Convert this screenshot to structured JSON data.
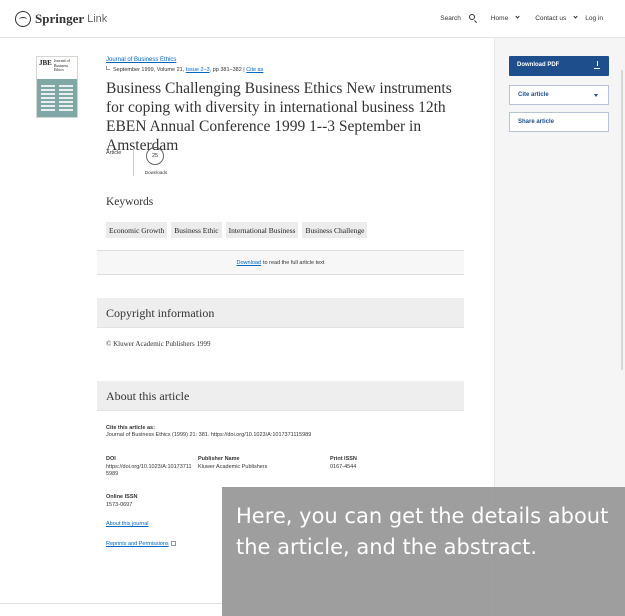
{
  "header": {
    "logo_brand": "Springer",
    "logo_product": "Link",
    "nav": {
      "search": "Search",
      "home": "Home",
      "contact": "Contact us",
      "login": "Log in"
    }
  },
  "cover": {
    "badge": "JBE",
    "title": "Journal of Business Ethics"
  },
  "article": {
    "journal": "Journal of Business Ethics",
    "date_volume": "September 1999, Volume 21,",
    "issue_link": "Issue 2–3",
    "pages": ", pp 381–382 |",
    "cite_link": "Cite as",
    "title": "Business Challenging Business Ethics New instruments for coping with diversity in international business 12th EBEN Annual Conference 1999 1--3 September in Amsterdam",
    "type": "Article",
    "downloads_count": "25",
    "downloads_label": "Downloads"
  },
  "keywords": {
    "heading": "Keywords",
    "items": [
      "Economic Growth",
      "Business Ethic",
      "International Business",
      "Business Challenge"
    ]
  },
  "download_box": {
    "link": "Download",
    "text": "to read the full article text"
  },
  "copyright": {
    "heading": "Copyright information",
    "text": "© Kluwer Academic Publishers 1999"
  },
  "about": {
    "heading": "About this article",
    "cite_label": "Cite this article as:",
    "cite_text": "Journal of Business Ethics (1999) 21: 381. https://doi.org/10.1023/A:1017371115989",
    "doi_label": "DOI",
    "doi_value_1": "https://doi.org/10.1023/A:10173711",
    "doi_value_2": "5989",
    "publisher_label": "Publisher Name",
    "publisher_value": "Kluwer Academic Publishers",
    "print_issn_label": "Print ISSN",
    "print_issn_value": "0167-4544",
    "online_issn_label": "Online ISSN",
    "online_issn_value": "1573-0697",
    "about_journal": "About this journal",
    "reprints": "Reprints and Permissions"
  },
  "sidebar": {
    "download_pdf": "Download PDF",
    "cite_article": "Cite article",
    "share_article": "Share article"
  },
  "overlay": {
    "text": "Here, you can get the details about the article, and the abstract."
  }
}
